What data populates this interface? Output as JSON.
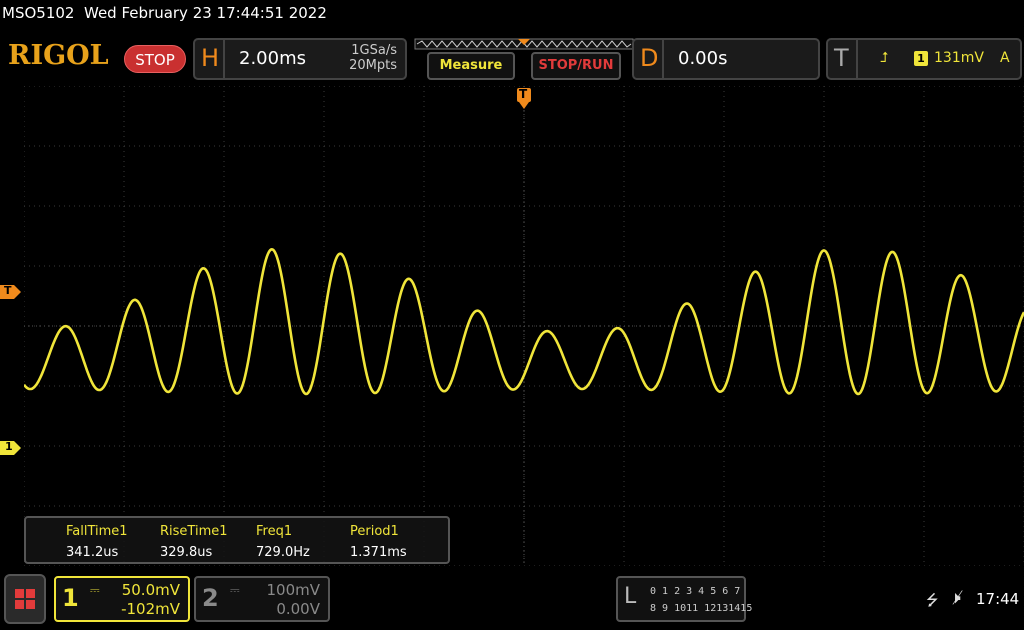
{
  "status": {
    "model": "MSO5102",
    "datetime": "Wed February 23 17:44:51 2022"
  },
  "header": {
    "logo": "RIGOL",
    "run_state": "STOP",
    "horizontal": {
      "letter": "H",
      "timebase": "2.00ms",
      "sample_rate": "1GSa/s",
      "memory_depth": "20Mpts"
    },
    "measure_label": "Measure",
    "stop_run_label": "STOP/RUN",
    "delay": {
      "letter": "D",
      "value": "0.00s"
    },
    "trigger": {
      "letter": "T",
      "edge_symbol": "⮥",
      "source": "1",
      "level": "131mV",
      "mode": "A"
    }
  },
  "markers": {
    "trigger_position": "T",
    "trigger_level": "T",
    "ch1_ground": "1"
  },
  "measurements": [
    {
      "name": "FallTime1",
      "value": "341.2us"
    },
    {
      "name": "RiseTime1",
      "value": "329.8us"
    },
    {
      "name": "Freq1",
      "value": "729.0Hz"
    },
    {
      "name": "Period1",
      "value": "1.371ms"
    }
  ],
  "channels": [
    {
      "num": "1",
      "coupling": "⎓",
      "scale": "50.0mV",
      "offset": "-102mV",
      "color": "#f0e53a",
      "active": true
    },
    {
      "num": "2",
      "coupling": "⎓",
      "scale": "100mV",
      "offset": "0.00V",
      "color": "#8a8a8a",
      "active": false
    }
  ],
  "logic": {
    "letter": "L",
    "row1": "0 1 2 3  4 5 6 7",
    "row2": "8 9 1011 12131415"
  },
  "system": {
    "usb_icon": "usb-icon",
    "speaker_icon": "speaker-muted-icon",
    "time": "17:44"
  },
  "colors": {
    "ch1": "#f0e53a",
    "accent_orange": "#f08a1c",
    "stop_red": "#c93030",
    "grid": "#3a3a3a"
  }
}
